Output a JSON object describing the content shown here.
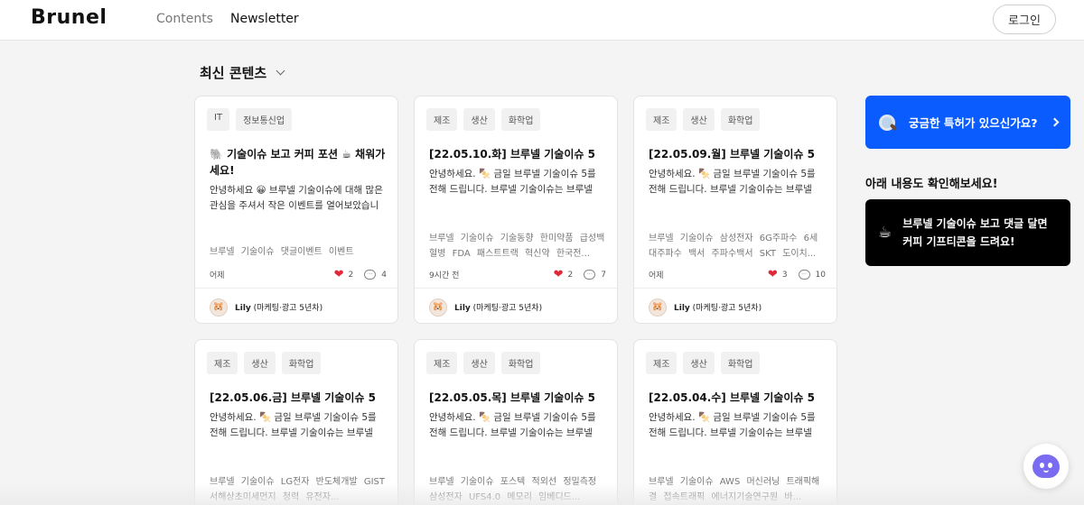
{
  "header": {
    "logo": "Brunel",
    "nav": [
      "Contents",
      "Newsletter"
    ],
    "login": "로그인"
  },
  "section": {
    "title": "최신 콘텐츠"
  },
  "cards": [
    {
      "tags": [
        "IT",
        "정보통신업"
      ],
      "title": "🐘 기술이슈 보고 커피 포션 ☕ 채워가세요!",
      "desc": "안녕하세요 😀 브루넬 기술이슈에 대해 많은 관심을 주셔서 작은 이벤트를 열어보았습니다...",
      "keywords": "브루넬 기술이슈 댓글이벤트 이벤트",
      "time": "어제",
      "likes": "2",
      "comments": "4",
      "author": "Lily",
      "author_role": "(마케팅·광고 5년차)"
    },
    {
      "tags": [
        "제조",
        "생산",
        "화학업"
      ],
      "title": "[22.05.10.화] 브루넬 기술이슈 5",
      "desc": "안녕하세요. 🍢 금일 브루넬 기술이슈 5를 전해 드립니다. 브루넬 기술이슈는 브루넬 사...",
      "keywords": "브루넬 기술이슈 기술동향 한미약품 급성백혈병 FDA 패스트트랙 혁신약 한국전...",
      "time": "9시간 전",
      "likes": "2",
      "comments": "7",
      "author": "Lily",
      "author_role": "(마케팅·광고 5년차)"
    },
    {
      "tags": [
        "제조",
        "생산",
        "화학업"
      ],
      "title": "[22.05.09.월] 브루넬 기술이슈 5",
      "desc": "안녕하세요. 🍢 금일 브루넬 기술이슈 5를 전해 드립니다. 브루넬 기술이슈는 브루넬 사...",
      "keywords": "브루넬 기술이슈 삼성전자 6G주파수 6세대주파수 백서 주파수백서 SKT 도이치...",
      "time": "어제",
      "likes": "3",
      "comments": "10",
      "author": "Lily",
      "author_role": "(마케팅·광고 5년차)"
    },
    {
      "tags": [
        "제조",
        "생산",
        "화학업"
      ],
      "title": "[22.05.06.금] 브루넬 기술이슈 5",
      "desc": "안녕하세요. 🍢 금일 브루넬 기술이슈 5를 전해 드립니다. 브루넬 기술이슈는 브루넬 사...",
      "keywords": "브루넬 기술이슈 LG전자 반도체개발 GIST 서해상초미세먼지 청력 유전자...",
      "time": "",
      "likes": "",
      "comments": "",
      "author": "",
      "author_role": ""
    },
    {
      "tags": [
        "제조",
        "생산",
        "화학업"
      ],
      "title": "[22.05.05.목] 브루넬 기술이슈 5",
      "desc": "안녕하세요. 🍢 금일 브루넬 기술이슈 5를 전해 드립니다. 브루넬 기술이슈는 브루넬 사...",
      "keywords": "브루넬 기술이슈 포스텍 적외선 정밀측정 삼성전자 UFS4.0 메모리 임베디드...",
      "time": "",
      "likes": "",
      "comments": "",
      "author": "",
      "author_role": ""
    },
    {
      "tags": [
        "제조",
        "생산",
        "화학업"
      ],
      "title": "[22.05.04.수] 브루넬 기술이슈 5",
      "desc": "안녕하세요. 🍢 금일 브루넬 기술이슈 5를 전해 드립니다. 브루넬 기술이슈는 브루넬 사...",
      "keywords": "브루넬 기술이슈 AWS 머신러닝 트래픽해결 접속트래픽 에너지기술연구원 바...",
      "time": "",
      "likes": "",
      "comments": "",
      "author": "",
      "author_role": ""
    }
  ],
  "side": {
    "patent_question": "궁금한 특허가 있으신가요?",
    "subtitle": "아래 내용도 확인해보세요!",
    "promo_line1": "브루넬 기술이슈 보고 댓글 달면",
    "promo_line2": "커피 기프티콘을 드려요!"
  },
  "colors": {
    "accent": "#0b5cff",
    "heart": "#e0283a"
  }
}
